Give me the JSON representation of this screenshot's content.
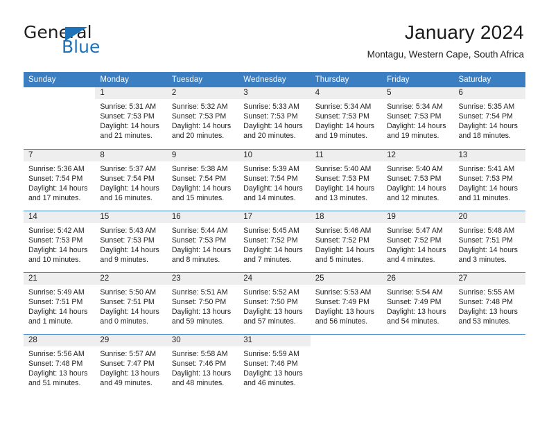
{
  "brand": {
    "name_part1": "General",
    "name_part2": "Blue",
    "accent_color": "#1d72b8"
  },
  "header": {
    "title": "January 2024",
    "subtitle": "Montagu, Western Cape, South Africa"
  },
  "theme": {
    "header_blue": "#3b7fc2",
    "daynum_bg": "#eeeeee",
    "text": "#222222"
  },
  "weekday_headers": [
    "Sunday",
    "Monday",
    "Tuesday",
    "Wednesday",
    "Thursday",
    "Friday",
    "Saturday"
  ],
  "weeks": [
    [
      {
        "day": "",
        "blank": true
      },
      {
        "day": "1",
        "sunrise": "Sunrise: 5:31 AM",
        "sunset": "Sunset: 7:53 PM",
        "daylight1": "Daylight: 14 hours",
        "daylight2": "and 21 minutes."
      },
      {
        "day": "2",
        "sunrise": "Sunrise: 5:32 AM",
        "sunset": "Sunset: 7:53 PM",
        "daylight1": "Daylight: 14 hours",
        "daylight2": "and 20 minutes."
      },
      {
        "day": "3",
        "sunrise": "Sunrise: 5:33 AM",
        "sunset": "Sunset: 7:53 PM",
        "daylight1": "Daylight: 14 hours",
        "daylight2": "and 20 minutes."
      },
      {
        "day": "4",
        "sunrise": "Sunrise: 5:34 AM",
        "sunset": "Sunset: 7:53 PM",
        "daylight1": "Daylight: 14 hours",
        "daylight2": "and 19 minutes."
      },
      {
        "day": "5",
        "sunrise": "Sunrise: 5:34 AM",
        "sunset": "Sunset: 7:53 PM",
        "daylight1": "Daylight: 14 hours",
        "daylight2": "and 19 minutes."
      },
      {
        "day": "6",
        "sunrise": "Sunrise: 5:35 AM",
        "sunset": "Sunset: 7:54 PM",
        "daylight1": "Daylight: 14 hours",
        "daylight2": "and 18 minutes."
      }
    ],
    [
      {
        "day": "7",
        "sunrise": "Sunrise: 5:36 AM",
        "sunset": "Sunset: 7:54 PM",
        "daylight1": "Daylight: 14 hours",
        "daylight2": "and 17 minutes."
      },
      {
        "day": "8",
        "sunrise": "Sunrise: 5:37 AM",
        "sunset": "Sunset: 7:54 PM",
        "daylight1": "Daylight: 14 hours",
        "daylight2": "and 16 minutes."
      },
      {
        "day": "9",
        "sunrise": "Sunrise: 5:38 AM",
        "sunset": "Sunset: 7:54 PM",
        "daylight1": "Daylight: 14 hours",
        "daylight2": "and 15 minutes."
      },
      {
        "day": "10",
        "sunrise": "Sunrise: 5:39 AM",
        "sunset": "Sunset: 7:54 PM",
        "daylight1": "Daylight: 14 hours",
        "daylight2": "and 14 minutes."
      },
      {
        "day": "11",
        "sunrise": "Sunrise: 5:40 AM",
        "sunset": "Sunset: 7:53 PM",
        "daylight1": "Daylight: 14 hours",
        "daylight2": "and 13 minutes."
      },
      {
        "day": "12",
        "sunrise": "Sunrise: 5:40 AM",
        "sunset": "Sunset: 7:53 PM",
        "daylight1": "Daylight: 14 hours",
        "daylight2": "and 12 minutes."
      },
      {
        "day": "13",
        "sunrise": "Sunrise: 5:41 AM",
        "sunset": "Sunset: 7:53 PM",
        "daylight1": "Daylight: 14 hours",
        "daylight2": "and 11 minutes."
      }
    ],
    [
      {
        "day": "14",
        "sunrise": "Sunrise: 5:42 AM",
        "sunset": "Sunset: 7:53 PM",
        "daylight1": "Daylight: 14 hours",
        "daylight2": "and 10 minutes."
      },
      {
        "day": "15",
        "sunrise": "Sunrise: 5:43 AM",
        "sunset": "Sunset: 7:53 PM",
        "daylight1": "Daylight: 14 hours",
        "daylight2": "and 9 minutes."
      },
      {
        "day": "16",
        "sunrise": "Sunrise: 5:44 AM",
        "sunset": "Sunset: 7:53 PM",
        "daylight1": "Daylight: 14 hours",
        "daylight2": "and 8 minutes."
      },
      {
        "day": "17",
        "sunrise": "Sunrise: 5:45 AM",
        "sunset": "Sunset: 7:52 PM",
        "daylight1": "Daylight: 14 hours",
        "daylight2": "and 7 minutes."
      },
      {
        "day": "18",
        "sunrise": "Sunrise: 5:46 AM",
        "sunset": "Sunset: 7:52 PM",
        "daylight1": "Daylight: 14 hours",
        "daylight2": "and 5 minutes."
      },
      {
        "day": "19",
        "sunrise": "Sunrise: 5:47 AM",
        "sunset": "Sunset: 7:52 PM",
        "daylight1": "Daylight: 14 hours",
        "daylight2": "and 4 minutes."
      },
      {
        "day": "20",
        "sunrise": "Sunrise: 5:48 AM",
        "sunset": "Sunset: 7:51 PM",
        "daylight1": "Daylight: 14 hours",
        "daylight2": "and 3 minutes."
      }
    ],
    [
      {
        "day": "21",
        "sunrise": "Sunrise: 5:49 AM",
        "sunset": "Sunset: 7:51 PM",
        "daylight1": "Daylight: 14 hours",
        "daylight2": "and 1 minute."
      },
      {
        "day": "22",
        "sunrise": "Sunrise: 5:50 AM",
        "sunset": "Sunset: 7:51 PM",
        "daylight1": "Daylight: 14 hours",
        "daylight2": "and 0 minutes."
      },
      {
        "day": "23",
        "sunrise": "Sunrise: 5:51 AM",
        "sunset": "Sunset: 7:50 PM",
        "daylight1": "Daylight: 13 hours",
        "daylight2": "and 59 minutes."
      },
      {
        "day": "24",
        "sunrise": "Sunrise: 5:52 AM",
        "sunset": "Sunset: 7:50 PM",
        "daylight1": "Daylight: 13 hours",
        "daylight2": "and 57 minutes."
      },
      {
        "day": "25",
        "sunrise": "Sunrise: 5:53 AM",
        "sunset": "Sunset: 7:49 PM",
        "daylight1": "Daylight: 13 hours",
        "daylight2": "and 56 minutes."
      },
      {
        "day": "26",
        "sunrise": "Sunrise: 5:54 AM",
        "sunset": "Sunset: 7:49 PM",
        "daylight1": "Daylight: 13 hours",
        "daylight2": "and 54 minutes."
      },
      {
        "day": "27",
        "sunrise": "Sunrise: 5:55 AM",
        "sunset": "Sunset: 7:48 PM",
        "daylight1": "Daylight: 13 hours",
        "daylight2": "and 53 minutes."
      }
    ],
    [
      {
        "day": "28",
        "sunrise": "Sunrise: 5:56 AM",
        "sunset": "Sunset: 7:48 PM",
        "daylight1": "Daylight: 13 hours",
        "daylight2": "and 51 minutes."
      },
      {
        "day": "29",
        "sunrise": "Sunrise: 5:57 AM",
        "sunset": "Sunset: 7:47 PM",
        "daylight1": "Daylight: 13 hours",
        "daylight2": "and 49 minutes."
      },
      {
        "day": "30",
        "sunrise": "Sunrise: 5:58 AM",
        "sunset": "Sunset: 7:46 PM",
        "daylight1": "Daylight: 13 hours",
        "daylight2": "and 48 minutes."
      },
      {
        "day": "31",
        "sunrise": "Sunrise: 5:59 AM",
        "sunset": "Sunset: 7:46 PM",
        "daylight1": "Daylight: 13 hours",
        "daylight2": "and 46 minutes."
      },
      {
        "day": "",
        "blank": true
      },
      {
        "day": "",
        "blank": true
      },
      {
        "day": "",
        "blank": true
      }
    ]
  ]
}
